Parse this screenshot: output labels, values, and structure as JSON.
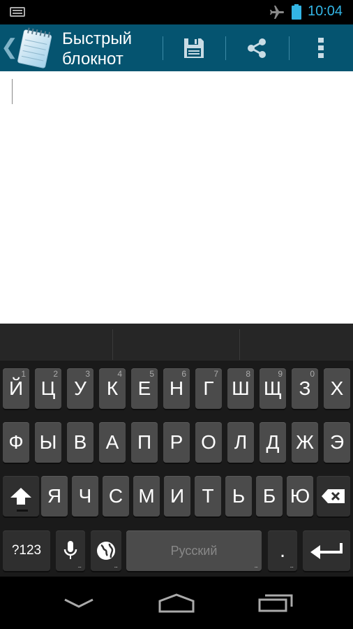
{
  "status_bar": {
    "time": "10:04",
    "clock_color": "#33b5e5"
  },
  "action_bar": {
    "title": "Быстрый блокнот",
    "background": "#055470",
    "actions": [
      {
        "name": "save-button",
        "icon": "save-icon"
      },
      {
        "name": "share-button",
        "icon": "share-icon"
      },
      {
        "name": "overflow-menu-button",
        "icon": "more-vert-icon"
      }
    ]
  },
  "editor": {
    "text": ""
  },
  "keyboard": {
    "row1": [
      {
        "label": "Й",
        "hint": "1"
      },
      {
        "label": "Ц",
        "hint": "2"
      },
      {
        "label": "У",
        "hint": "3"
      },
      {
        "label": "К",
        "hint": "4"
      },
      {
        "label": "Е",
        "hint": "5"
      },
      {
        "label": "Н",
        "hint": "6"
      },
      {
        "label": "Г",
        "hint": "7"
      },
      {
        "label": "Ш",
        "hint": "8"
      },
      {
        "label": "Щ",
        "hint": "9"
      },
      {
        "label": "З",
        "hint": "0"
      },
      {
        "label": "Х",
        "hint": ""
      }
    ],
    "row2": [
      "Ф",
      "Ы",
      "В",
      "А",
      "П",
      "Р",
      "О",
      "Л",
      "Д",
      "Ж",
      "Э"
    ],
    "row3": [
      "Я",
      "Ч",
      "С",
      "М",
      "И",
      "Т",
      "Ь",
      "Б",
      "Ю"
    ],
    "symbols_label": "?123",
    "space_label": "Русский",
    "period_label": ".",
    "dots": "..."
  },
  "nav_bar": {
    "buttons": [
      "back",
      "home",
      "recents"
    ]
  }
}
